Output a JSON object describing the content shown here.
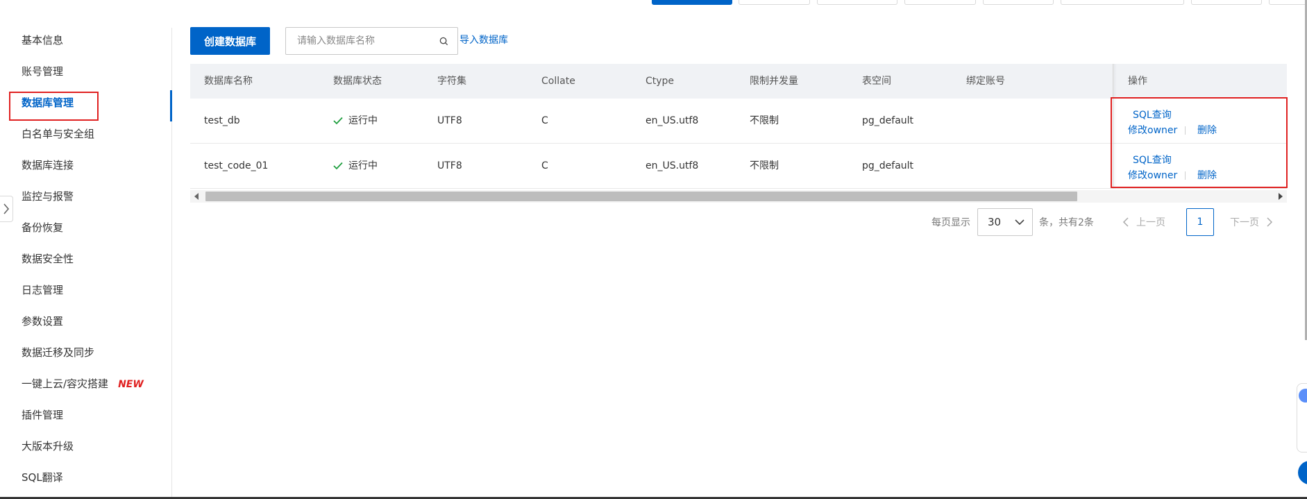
{
  "sidebar": {
    "items": [
      {
        "label": "基本信息"
      },
      {
        "label": "账号管理"
      },
      {
        "label": "数据库管理"
      },
      {
        "label": "白名单与安全组"
      },
      {
        "label": "数据库连接"
      },
      {
        "label": "监控与报警"
      },
      {
        "label": "备份恢复"
      },
      {
        "label": "数据安全性"
      },
      {
        "label": "日志管理"
      },
      {
        "label": "参数设置"
      },
      {
        "label": "数据迁移及同步"
      },
      {
        "label": "一键上云/容灾搭建",
        "badge": "NEW"
      },
      {
        "label": "插件管理"
      },
      {
        "label": "大版本升级"
      },
      {
        "label": "SQL翻译"
      }
    ],
    "active": "数据库管理"
  },
  "toolbar": {
    "create_label": "创建数据库",
    "search_placeholder": "请输入数据库名称",
    "import_label": "导入数据库"
  },
  "table": {
    "columns": [
      "数据库名称",
      "数据库状态",
      "字符集",
      "Collate",
      "Ctype",
      "限制并发量",
      "表空间",
      "绑定账号",
      "操作"
    ],
    "rows": [
      {
        "name": "test_db",
        "status": "运行中",
        "charset": "UTF8",
        "collate": "C",
        "ctype": "en_US.utf8",
        "limit": "不限制",
        "tablespace": "pg_default",
        "account": "",
        "ops": [
          "SQL查询",
          "修改owner",
          "删除"
        ]
      },
      {
        "name": "test_code_01",
        "status": "运行中",
        "charset": "UTF8",
        "collate": "C",
        "ctype": "en_US.utf8",
        "limit": "不限制",
        "tablespace": "pg_default",
        "account": "",
        "ops": [
          "SQL查询",
          "修改owner",
          "删除"
        ]
      }
    ]
  },
  "pagination": {
    "per_page_label": "每页显示",
    "page_size": "30",
    "total_label": "条，共有2条",
    "prev_label": "上一页",
    "current_page": "1",
    "next_label": "下一页"
  },
  "colors": {
    "accent": "#0064c8",
    "highlight": "#e02020",
    "success": "#1e9e3e",
    "new_badge": "#e02020"
  }
}
